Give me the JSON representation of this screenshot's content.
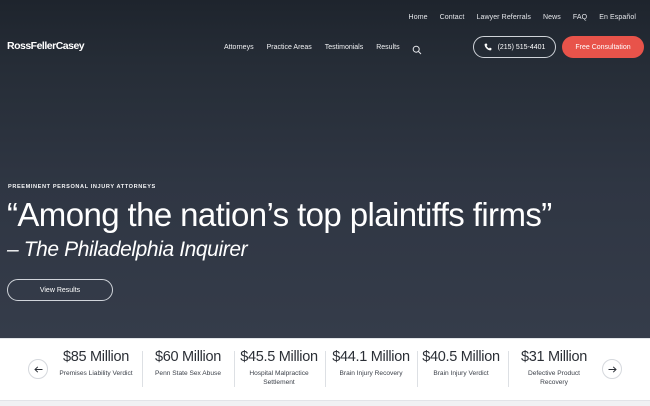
{
  "topbar": {
    "links": [
      "Home",
      "Contact",
      "Lawyer Referrals",
      "News",
      "FAQ",
      "En Español"
    ]
  },
  "brand": {
    "logo_text": "RossFellerCasey"
  },
  "nav": {
    "items": [
      "Attorneys",
      "Practice Areas",
      "Testimonials",
      "Results"
    ],
    "search_icon": "search-icon"
  },
  "cta": {
    "phone_label": "(215) 515-4401",
    "phone_icon": "phone-icon",
    "consult_label": "Free Consultation",
    "consult_color": "#e8534a"
  },
  "hero": {
    "eyebrow": "PREEMINENT PERSONAL INJURY ATTORNEYS",
    "quote": "“Among the nation’s top plaintiffs firms”",
    "attribution": "– The Philadelphia Inquirer",
    "button_label": "View Results"
  },
  "results": {
    "prev_icon": "arrow-left-icon",
    "next_icon": "arrow-right-icon",
    "items": [
      {
        "amount": "$85 Million",
        "label": "Premises Liability Verdict"
      },
      {
        "amount": "$60 Million",
        "label": "Penn State Sex Abuse"
      },
      {
        "amount": "$45.5 Million",
        "label": "Hospital Malpractice Settlement"
      },
      {
        "amount": "$44.1 Million",
        "label": "Brain Injury Recovery"
      },
      {
        "amount": "$40.5 Million",
        "label": "Brain Injury Verdict"
      },
      {
        "amount": "$31 Million",
        "label": "Defective Product Recovery"
      }
    ]
  }
}
